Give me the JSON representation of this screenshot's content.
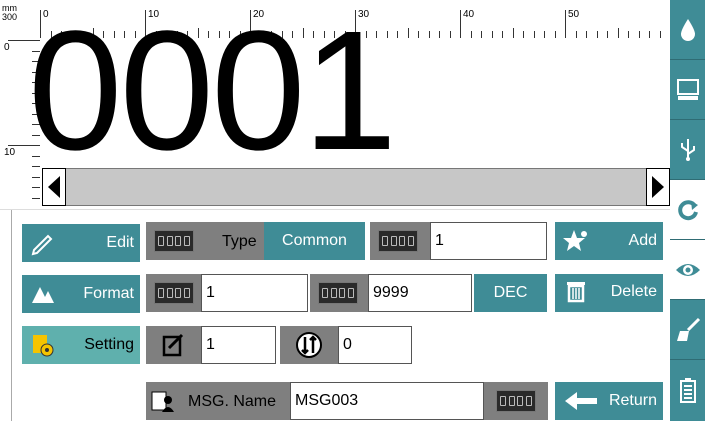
{
  "ruler": {
    "unit_label": "mm\n300",
    "h_labels": [
      "0",
      "10",
      "20",
      "30",
      "40",
      "50"
    ],
    "v_labels": [
      "0",
      "10"
    ]
  },
  "preview": {
    "text": "0001"
  },
  "left_menu": {
    "edit": "Edit",
    "format": "Format",
    "setting": "Setting"
  },
  "row1": {
    "type_label": "Type",
    "type_value": "Common",
    "step_value": "1"
  },
  "row2": {
    "start_value": "1",
    "end_value": "9999",
    "base": "DEC"
  },
  "row3": {
    "repeat_value": "1",
    "reset_value": "0"
  },
  "row4": {
    "msg_label": "MSG. Name",
    "msg_value": "MSG003"
  },
  "right_menu": {
    "add": "Add",
    "delete": "Delete",
    "return": "Return"
  },
  "sidebar_icons": [
    "ink-drop-icon",
    "monitor-icon",
    "usb-icon",
    "refresh-icon",
    "eye-icon",
    "clean-icon",
    "battery-icon"
  ],
  "colors": {
    "accent": "#3f8c96",
    "active": "#5fb0ad",
    "gray": "#7f7f7f"
  }
}
